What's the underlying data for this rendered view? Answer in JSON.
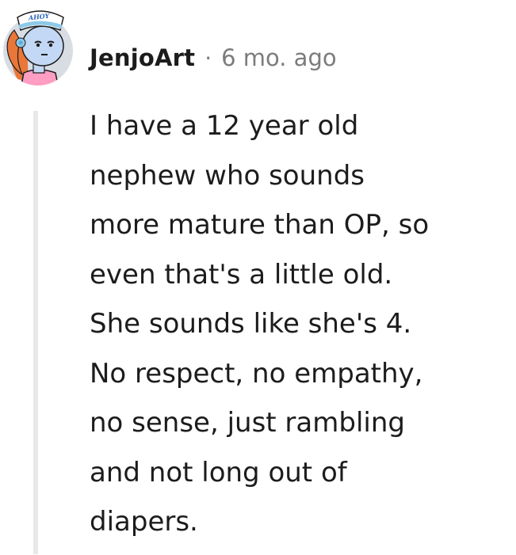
{
  "comment": {
    "username": "JenjoArt",
    "separator": "·",
    "timestamp": "6 mo. ago",
    "avatar": {
      "hat_text": "AHOY"
    },
    "body_lines": [
      "I have a 12 year old",
      "nephew who sounds",
      "more mature than OP, so",
      "even that's a little old.",
      "She sounds like she's 4.",
      "No respect, no empathy,",
      "no sense, just rambling",
      "and not long out of",
      "diapers."
    ]
  },
  "colors": {
    "text": "#1c1c1c",
    "meta_text": "#7c7c7c",
    "thread_line": "#e8e8e8",
    "avatar_bg": "#d8dde3",
    "avatar_hair": "#e9773a",
    "avatar_skin": "#c3d8f4",
    "avatar_shirt": "#ff9dc2"
  }
}
